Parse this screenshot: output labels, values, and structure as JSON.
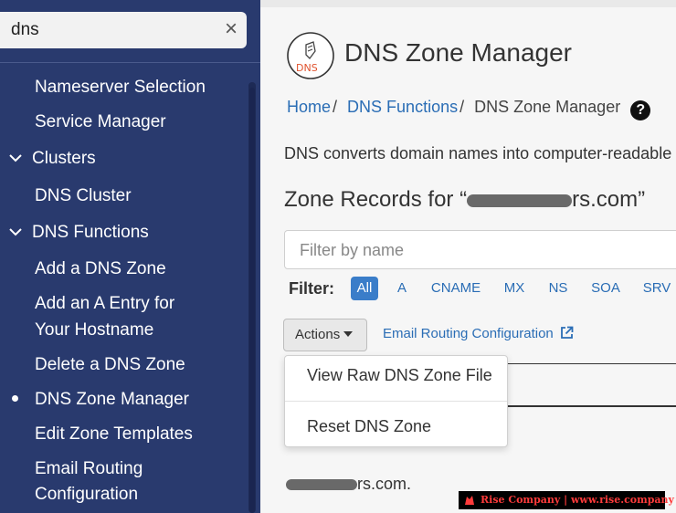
{
  "sidebar": {
    "search_value": "dns",
    "clear_icon": "×",
    "items": [
      {
        "label": "Nameserver Selection"
      },
      {
        "label": "Service Manager"
      },
      {
        "label": "Clusters"
      },
      {
        "label": "DNS Cluster"
      },
      {
        "label": "DNS Functions"
      },
      {
        "label": "Add a DNS Zone"
      },
      {
        "label": "Add an A Entry for"
      },
      {
        "label": "Your Hostname"
      },
      {
        "label": "Delete a DNS Zone"
      },
      {
        "label": "DNS Zone Manager"
      },
      {
        "label": "Edit Zone Templates"
      },
      {
        "label": "Email Routing"
      },
      {
        "label": "Configuration"
      }
    ],
    "active_item": "DNS Zone Manager"
  },
  "main": {
    "logo_text": "DNS",
    "page_title": "DNS Zone Manager",
    "breadcrumb": {
      "home": "Home",
      "sep": "/",
      "functions": "DNS Functions",
      "current": "DNS Zone Manager",
      "help": "?"
    },
    "description": "DNS converts domain names into computer-readable",
    "zone_title_prefix": "Zone Records for “",
    "zone_title_suffix": "rs.com”",
    "filter_placeholder": "Filter by name",
    "filter_label": "Filter:",
    "filter_chips": [
      "All",
      "A",
      "CNAME",
      "MX",
      "NS",
      "SOA",
      "SRV"
    ],
    "active_chip": "All",
    "actions_label": "Actions",
    "email_routing_link": "Email Routing Configuration",
    "row_domain_suffix": "rs.com."
  },
  "dropdown": {
    "items": [
      "View Raw DNS Zone File",
      "Reset DNS Zone"
    ]
  },
  "watermark": {
    "text": "Rise Company | www.rise.company"
  },
  "colors": {
    "sidebar_bg": "#293a6e",
    "link": "#2a6db5",
    "chip_active": "#3a7dc9",
    "watermark_text": "#ff3b3b"
  }
}
